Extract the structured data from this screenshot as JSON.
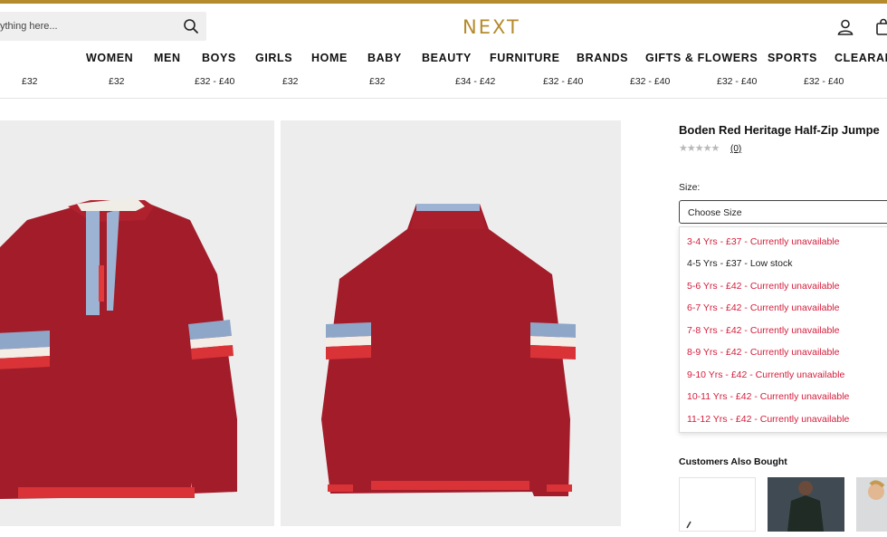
{
  "header": {
    "brand": "NEXT",
    "search_placeholder": "ything here...",
    "accent_color": "#b58a2c"
  },
  "nav": {
    "items": [
      {
        "label": "WOMEN"
      },
      {
        "label": "MEN"
      },
      {
        "label": "BOYS"
      },
      {
        "label": "GIRLS"
      },
      {
        "label": "HOME"
      },
      {
        "label": "BABY"
      },
      {
        "label": "BEAUTY"
      },
      {
        "label": "FURNITURE"
      },
      {
        "label": "BRANDS"
      },
      {
        "label": "GIFTS & FLOWERS"
      },
      {
        "label": "SPORTS"
      },
      {
        "label": "CLEARAN"
      }
    ],
    "prices": [
      "£32",
      "£32",
      "£32 - £40",
      "£32",
      "£32",
      "£34 - £42",
      "£32 - £40",
      "£32 - £40",
      "£32 - £40",
      "£32 - £40"
    ]
  },
  "product": {
    "title": "Boden Red Heritage Half-Zip Jumpe",
    "stars": "★★★★★",
    "review_count": "(0)",
    "size_label": "Size:",
    "select_value": "Choose Size",
    "size_options": [
      {
        "label": "3-4 Yrs - £37 - Currently unavailable",
        "available": false
      },
      {
        "label": "4-5 Yrs - £37 - Low stock",
        "available": true
      },
      {
        "label": "5-6 Yrs - £42 - Currently unavailable",
        "available": false
      },
      {
        "label": "6-7 Yrs - £42 - Currently unavailable",
        "available": false
      },
      {
        "label": "7-8 Yrs - £42 - Currently unavailable",
        "available": false
      },
      {
        "label": "8-9 Yrs - £42 - Currently unavailable",
        "available": false
      },
      {
        "label": "9-10 Yrs - £42 - Currently unavailable",
        "available": false
      },
      {
        "label": "10-11 Yrs - £42 - Currently unavailable",
        "available": false
      },
      {
        "label": "11-12 Yrs - £42 - Currently unavailable",
        "available": false
      }
    ],
    "unavailable_color": "#d51c3a"
  },
  "recommendations": {
    "title": "Customers Also Bought"
  }
}
